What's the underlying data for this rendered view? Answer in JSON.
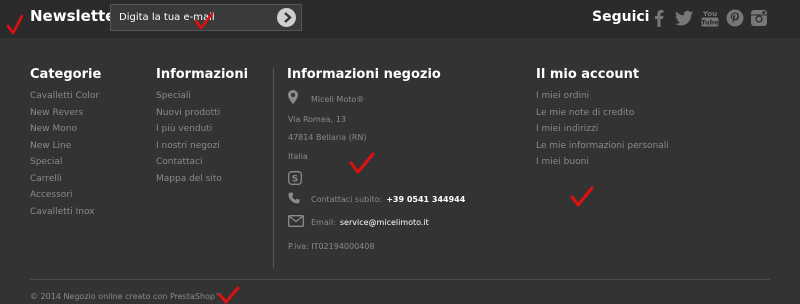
{
  "newsletter": {
    "title": "Newsletter",
    "input_placeholder": "Digita la tua e-mail",
    "submit_icon": "arrow-right-circle-icon"
  },
  "follow": {
    "title": "Seguici",
    "icons": [
      "facebook-icon",
      "twitter-icon",
      "youtube-icon",
      "pinterest-icon",
      "instagram-icon"
    ]
  },
  "categories": {
    "title": "Categorie",
    "items": [
      "Cavalletti Color",
      "New Revers",
      "New Mono",
      "New Line",
      "Special",
      "Carrelli",
      "Accessori",
      "Cavalletti Inox"
    ]
  },
  "information": {
    "title": "Informazioni",
    "items": [
      "Speciali",
      "Nuovi prodotti",
      "I più venduti",
      "I nostri negozi",
      "Contattaci",
      "Mappa del sito"
    ]
  },
  "store": {
    "title": "Informazioni negozio",
    "name": "Miceli Moto®",
    "street": "Via Romea, 13",
    "city": "47814 Bellaria (RN)",
    "country": "Italia",
    "call_label": "Contattaci subito:",
    "phone": "+39 0541 344944",
    "email_label": "Email:",
    "email": "service@micelimoto.it",
    "vat": "P.iva: IT02194000408"
  },
  "account": {
    "title": "Il mio account",
    "items": [
      "I miei ordini",
      "Le mie note di credito",
      "I miei indirizzi",
      "Le mie informazioni personali",
      "I miei buoni"
    ]
  },
  "footer": {
    "copyright": "© 2014 Negozio online creato con PrestaShop™"
  },
  "colors": {
    "background": "#333333",
    "topbar": "#2b2b2b",
    "heading": "#ffffff",
    "link": "#8a8a8a",
    "annotation_check": "#e01010"
  }
}
